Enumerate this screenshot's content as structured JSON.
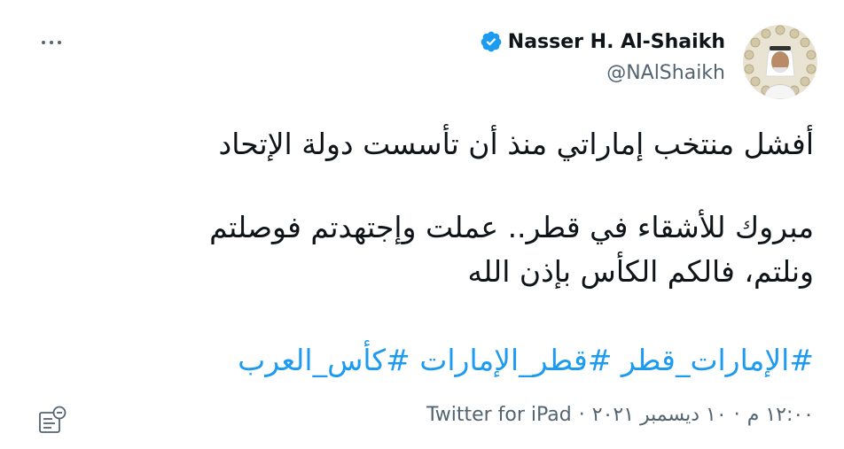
{
  "tweet": {
    "display_name": "Nasser H. Al-Shaikh",
    "handle": "@NAlShaikh",
    "text_line1": "أفشل منتخب إماراتي منذ أن تأسست دولة الإتحاد",
    "text_line2": "مبروك للأشقاء في قطر.. عملت وإجتهدتم فوصلتم",
    "text_line3": "ونلتم، فالكم الكأس بإذن الله",
    "hashtags": [
      "#الإمارات_قطر",
      "#قطر_الإمارات",
      "#كأس_العرب"
    ],
    "time": "١٢:٠٠ م",
    "date": "١٠ ديسمبر ٢٠٢١",
    "separator": "·",
    "source": "Twitter for iPad"
  },
  "icons": {
    "more": "more-horizontal-icon",
    "verified": "verified-badge-icon",
    "analytics": "analytics-icon"
  },
  "colors": {
    "accent": "#1d9bf0",
    "text": "#0f1419",
    "secondary": "#536471",
    "background": "#ffffff"
  }
}
